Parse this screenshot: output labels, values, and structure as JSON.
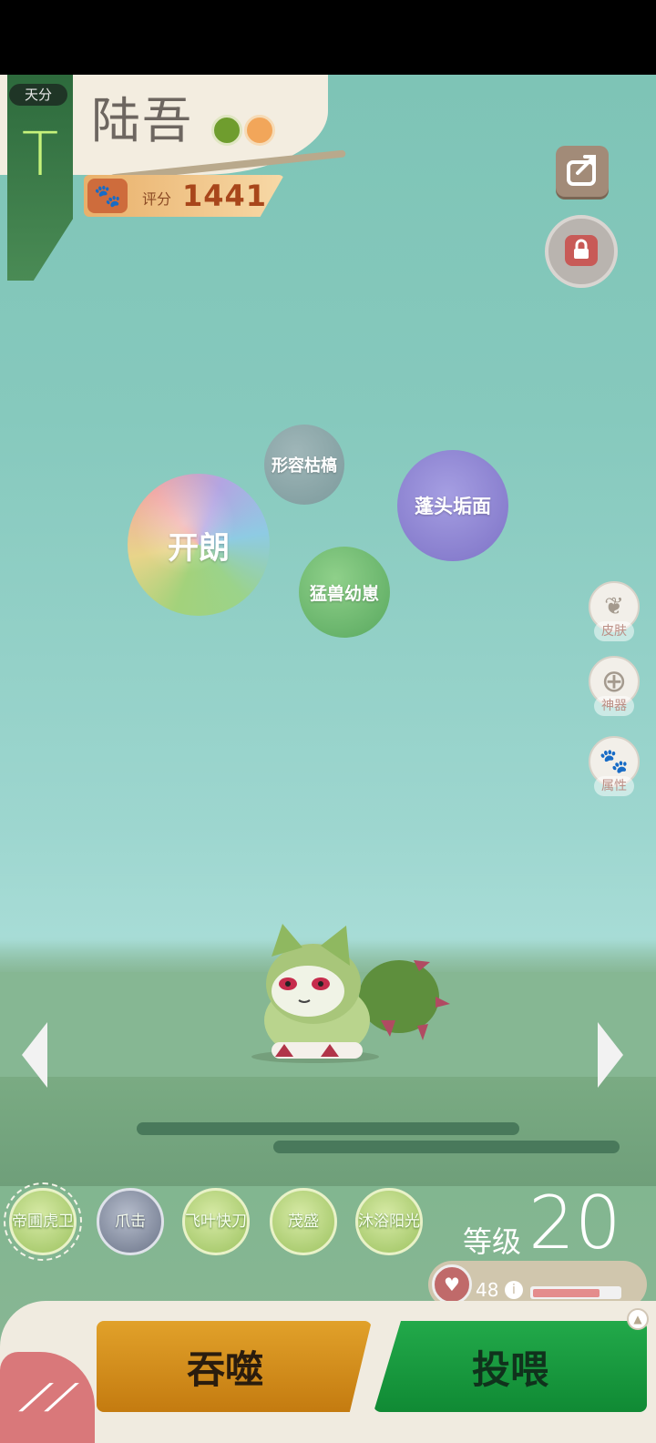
{
  "header": {
    "tier_label": "天分",
    "tier_grade": "T",
    "pet_name": "陆吾",
    "score_label": "评分",
    "score_value": "1441",
    "element_icons": [
      "leaf-element-icon",
      "sun-element-icon"
    ]
  },
  "top_buttons": {
    "share_icon": "share-icon",
    "lock_icon": "lock-icon"
  },
  "traits": [
    {
      "label": "开朗",
      "color": "rainbow"
    },
    {
      "label": "形容枯槁",
      "color": "#8faaad"
    },
    {
      "label": "蓬头垢面",
      "color": "#9188d6"
    },
    {
      "label": "猛兽幼崽",
      "color": "#6cba6f"
    }
  ],
  "side_menu": [
    {
      "label": "皮肤",
      "icon": "butterfly-icon"
    },
    {
      "label": "神器",
      "icon": "plus-icon"
    },
    {
      "label": "属性",
      "icon": "paw-icon"
    }
  ],
  "skills": [
    {
      "label": "帝圃虎卫",
      "selected": true
    },
    {
      "label": "爪击",
      "selected": false
    },
    {
      "label": "飞叶快刀",
      "selected": false
    },
    {
      "label": "茂盛",
      "selected": false
    },
    {
      "label": "沐浴阳光",
      "selected": false
    }
  ],
  "level": {
    "label": "等级",
    "value": "20"
  },
  "hp": {
    "value": "48",
    "fill_fraction": 0.78
  },
  "actions": {
    "devour": "吞噬",
    "feed": "投喂"
  },
  "colors": {
    "accent_green": "#22a94a",
    "accent_orange": "#e1a12a",
    "scene_teal": "#86c9bd"
  }
}
